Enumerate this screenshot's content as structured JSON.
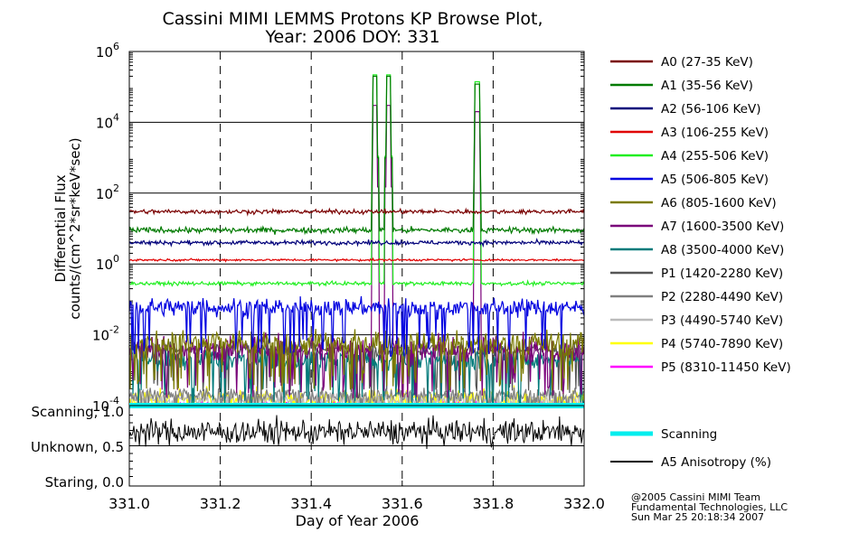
{
  "title": "Cassini MIMI LEMMS Protons KP Browse Plot,",
  "subtitle": "Year: 2006 DOY: 331",
  "footer": {
    "line1": "@2005 Cassini MIMI Team",
    "line2": "Fundamental Technologies, LLC",
    "line3": "Sun Mar 25 20:18:34 2007"
  },
  "chart_data": [
    {
      "type": "line",
      "ylabel_line1": "Differential Flux",
      "ylabel_line2": "counts/(cm^2*sr*keV*sec)",
      "xlim": [
        331.0,
        332.0
      ],
      "ylim": [
        0.0001,
        1000000
      ],
      "yscale": "log",
      "y_ticks": [
        {
          "value": 0.0001,
          "base": "10",
          "exp": "-4"
        },
        {
          "value": 0.01,
          "base": "10",
          "exp": "-2"
        },
        {
          "value": 1,
          "base": "10",
          "exp": "0"
        },
        {
          "value": 100,
          "base": "10",
          "exp": "2"
        },
        {
          "value": 10000,
          "base": "10",
          "exp": "4"
        },
        {
          "value": 1000000,
          "base": "10",
          "exp": "6"
        }
      ],
      "grid": true,
      "legend_position": "right",
      "series": [
        {
          "name": "A0 (27-35 KeV)",
          "color": "#7a0000",
          "baseline": 30,
          "noise": 0.06,
          "spikes": []
        },
        {
          "name": "A1 (35-56 KeV)",
          "color": "#007a00",
          "baseline": 9,
          "noise": 0.08,
          "spikes": [
            {
              "x": 331.54,
              "y": 200000
            },
            {
              "x": 331.57,
              "y": 200000
            },
            {
              "x": 331.765,
              "y": 120000
            }
          ]
        },
        {
          "name": "A2 (56-106 KeV)",
          "color": "#00007a",
          "baseline": 4,
          "noise": 0.06,
          "spikes": []
        },
        {
          "name": "A3 (106-255 KeV)",
          "color": "#e00000",
          "baseline": 1.3,
          "noise": 0.03,
          "spikes": []
        },
        {
          "name": "A4 (255-506 KeV)",
          "color": "#22ee22",
          "baseline": 0.28,
          "noise": 0.05,
          "spikes": [
            {
              "x": 331.54,
              "y": 220000
            },
            {
              "x": 331.57,
              "y": 220000
            },
            {
              "x": 331.765,
              "y": 140000
            }
          ]
        },
        {
          "name": "A5 (506-805 KeV)",
          "color": "#0000e0",
          "baseline": 0.06,
          "noise": 0.25,
          "spikes": []
        },
        {
          "name": "A6 (805-1600 KeV)",
          "color": "#7a7a00",
          "baseline": 0.006,
          "noise": 0.35,
          "spikes": []
        },
        {
          "name": "A7 (1600-3500 KeV)",
          "color": "#7a007a",
          "baseline": 0.004,
          "noise": 0.4,
          "spikes": [
            {
              "x": 331.54,
              "y": 30000
            },
            {
              "x": 331.57,
              "y": 30000
            },
            {
              "x": 331.765,
              "y": 20000
            }
          ]
        },
        {
          "name": "A8 (3500-4000 KeV)",
          "color": "#007a7a",
          "baseline": 0.002,
          "noise": 0.3,
          "spikes": []
        },
        {
          "name": "P1 (1420-2280 KeV)",
          "color": "#555555",
          "baseline": 0.004,
          "noise": 0.2,
          "spikes": []
        },
        {
          "name": "P2 (2280-4490 KeV)",
          "color": "#808080",
          "baseline": 0.0002,
          "noise": 0.2,
          "spikes": []
        },
        {
          "name": "P3 (4490-5740 KeV)",
          "color": "#bbbbbb",
          "baseline": 0.00015,
          "noise": 0.2,
          "spikes": []
        },
        {
          "name": "P4 (5740-7890 KeV)",
          "color": "#ffff00",
          "baseline": 0.00015,
          "noise": 0.3,
          "spikes": []
        },
        {
          "name": "P5 (8310-11450 KeV)",
          "color": "#ff00ff",
          "baseline": 0.0001,
          "noise": 0.1,
          "spikes": []
        }
      ]
    },
    {
      "type": "line",
      "xlabel": "Day of Year 2006",
      "xlim": [
        331.0,
        332.0
      ],
      "x_ticks": [
        "331.0",
        "331.2",
        "331.4",
        "331.6",
        "331.8",
        "332.0"
      ],
      "ylim": [
        0.0,
        1.0
      ],
      "y_ticks": [
        "Scanning, 1.0",
        "Unknown, 0.5",
        "Staring, 0.0"
      ],
      "grid": true,
      "legend_position": "right",
      "series": [
        {
          "name": "Scanning",
          "color": "#00eeee",
          "value": 1.0
        },
        {
          "name": "A5 Anisotropy (%)",
          "color": "#000000",
          "baseline": 0.68,
          "noise": 0.08
        }
      ]
    }
  ]
}
